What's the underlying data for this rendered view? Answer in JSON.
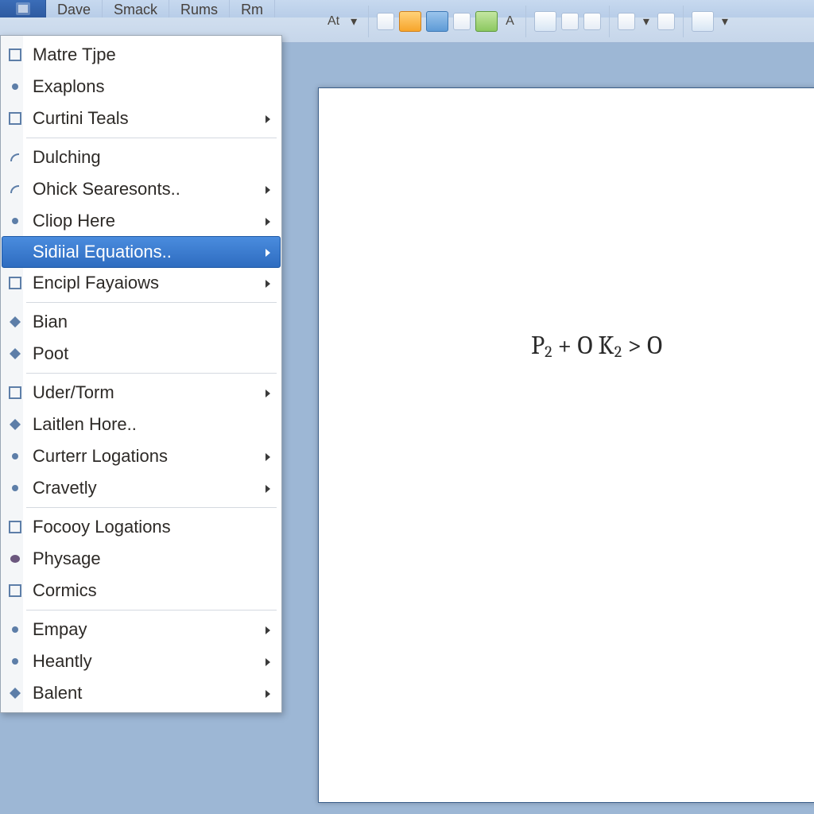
{
  "tabs": {
    "items": [
      "Dave",
      "Smack",
      "Rums",
      "Rm"
    ]
  },
  "ribbon": {
    "label_at": "At",
    "label_a": "A"
  },
  "menu": {
    "groups": [
      [
        {
          "label": "Matre Tjpe",
          "icon": "box",
          "submenu": false
        },
        {
          "label": "Exaplons",
          "icon": "dot",
          "submenu": false
        },
        {
          "label": "Curtini Teals",
          "icon": "box",
          "submenu": true
        }
      ],
      [
        {
          "label": "Dulching",
          "icon": "swirl",
          "submenu": false
        },
        {
          "label": "Ohick Searesonts..",
          "icon": "swirl",
          "submenu": true
        },
        {
          "label": "Cliop Here",
          "icon": "dot",
          "submenu": true
        },
        {
          "label": "Sidiial Equations..",
          "icon": "blank",
          "submenu": true,
          "hover": true
        },
        {
          "label": "Encipl Fayaiows",
          "icon": "box",
          "submenu": true
        }
      ],
      [
        {
          "label": "Bian",
          "icon": "diamond",
          "submenu": false
        },
        {
          "label": "Poot",
          "icon": "diamond",
          "submenu": false
        }
      ],
      [
        {
          "label": "Uder/Torm",
          "icon": "box",
          "submenu": true
        },
        {
          "label": "Laitlen Hore..",
          "icon": "diamond",
          "submenu": false
        },
        {
          "label": "Curterr Logations",
          "icon": "dot",
          "submenu": true
        },
        {
          "label": "Cravetly",
          "icon": "dot",
          "submenu": true
        }
      ],
      [
        {
          "label": "Focooy Logations",
          "icon": "box",
          "submenu": false
        },
        {
          "label": "Physage",
          "icon": "blob",
          "submenu": false
        },
        {
          "label": "Cormics",
          "icon": "box",
          "submenu": false
        }
      ],
      [
        {
          "label": "Empay",
          "icon": "dot",
          "submenu": true
        },
        {
          "label": "Heantly",
          "icon": "dot",
          "submenu": true
        },
        {
          "label": "Balent",
          "icon": "diamond",
          "submenu": true
        }
      ]
    ]
  },
  "document": {
    "equation": "P₂ + O K₂ > O"
  }
}
